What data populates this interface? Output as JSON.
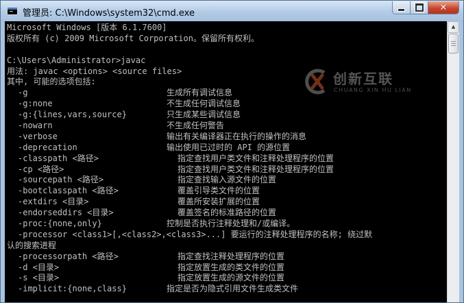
{
  "window": {
    "title": "管理员: C:\\Windows\\system32\\cmd.exe",
    "icon": "console-icon"
  },
  "controls": {
    "minimize_icon": "minimize-icon",
    "maximize_icon": "maximize-icon",
    "close_icon": "close-icon",
    "close_glyph": "✕"
  },
  "console": {
    "text_color": "#c0c0c0",
    "background": "#000000",
    "lines": [
      "Microsoft Windows [版本 6.1.7600]",
      "版权所有 (c) 2009 Microsoft Corporation。保留所有权利。",
      "",
      "C:\\Users\\Administrator>javac",
      "用法: javac <options> <source files>",
      "其中, 可能的选项包括:"
    ],
    "options": [
      {
        "opt": "-g",
        "desc": "生成所有调试信息",
        "col": 1
      },
      {
        "opt": "-g:none",
        "desc": "不生成任何调试信息",
        "col": 1
      },
      {
        "opt": "-g:{lines,vars,source}",
        "desc": "只生成某些调试信息",
        "col": 1
      },
      {
        "opt": "-nowarn",
        "desc": "不生成任何警告",
        "col": 1
      },
      {
        "opt": "-verbose",
        "desc": "输出有关编译器正在执行的操作的消息",
        "col": 1
      },
      {
        "opt": "-deprecation",
        "desc": "输出使用已过时的 API 的源位置",
        "col": 1
      },
      {
        "opt": "-classpath <路径>",
        "desc": "指定查找用户类文件和注释处理程序的位置",
        "col": 2
      },
      {
        "opt": "-cp <路径>",
        "desc": "指定查找用户类文件和注释处理程序的位置",
        "col": 2
      },
      {
        "opt": "-sourcepath <路径>",
        "desc": "指定查找输入源文件的位置",
        "col": 2
      },
      {
        "opt": "-bootclasspath <路径>",
        "desc": "覆盖引导类文件的位置",
        "col": 2
      },
      {
        "opt": "-extdirs <目录>",
        "desc": "覆盖所安装扩展的位置",
        "col": 2
      },
      {
        "opt": "-endorseddirs <目录>",
        "desc": "覆盖签名的标准路径的位置",
        "col": 2
      },
      {
        "opt": "-proc:{none,only}",
        "desc": "控制是否执行注释处理和/或编译。",
        "col": 1
      },
      {
        "opt": "-processor <class1>[,<class2>,<class3>...] 要运行的注释处理程序的名称; 绕过默",
        "desc": "",
        "col": 0
      },
      {
        "opt": "",
        "desc": "认的搜索进程",
        "col": -1
      },
      {
        "opt": "-processorpath <路径>",
        "desc": "指定查找注释处理程序的位置",
        "col": 2
      },
      {
        "opt": "-d <目录>",
        "desc": "指定放置生成的类文件的位置",
        "col": 2
      },
      {
        "opt": "-s <目录>",
        "desc": "指定放置生成的源文件的位置",
        "col": 2
      },
      {
        "opt": "-implicit:{none,class}",
        "desc": "指定是否为隐式引用文件生成类文件",
        "col": 1
      }
    ]
  },
  "watermark": {
    "brand": "创新互联",
    "sub": "CHUANG XIN HU LIAN"
  },
  "scrollbar": {
    "up_arrow": "▲"
  }
}
